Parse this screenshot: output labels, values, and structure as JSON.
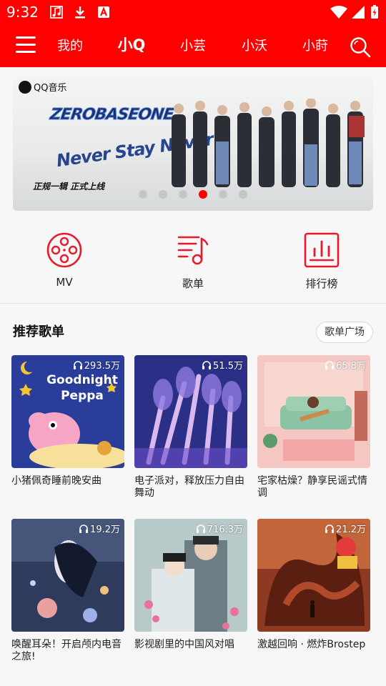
{
  "status_bar": {
    "time": "9:32",
    "left_icons": [
      "music-note-icon",
      "download-icon",
      "app-notification-icon"
    ],
    "right_icons": [
      "wifi-icon",
      "signal-icon",
      "battery-icon"
    ]
  },
  "nav": {
    "tabs": [
      {
        "label": "我的",
        "active": false
      },
      {
        "label": "小Q",
        "active": true
      },
      {
        "label": "小芸",
        "active": false
      },
      {
        "label": "小沃",
        "active": false
      },
      {
        "label": "小莳",
        "active": false
      }
    ]
  },
  "banner": {
    "brand": "QQ音乐",
    "title_line1": "ZEROBASEONE",
    "title_line2": "Never Stay Never",
    "subtitle": "正规一辑 正式上线",
    "active_dot": 3,
    "dot_count": 6
  },
  "quick_actions": [
    {
      "label": "MV",
      "icon": "film-reel-icon"
    },
    {
      "label": "歌单",
      "icon": "playlist-icon"
    },
    {
      "label": "排行榜",
      "icon": "chart-icon"
    }
  ],
  "section": {
    "title": "推荐歌单",
    "more_label": "歌单广场"
  },
  "playlists": [
    {
      "title": "小猪佩奇睡前晚安曲",
      "plays": "293.5万",
      "cover_text": "Goodnight Peppa"
    },
    {
      "title": "电子派对，释放压力自由舞动",
      "plays": "51.5万"
    },
    {
      "title": "宅家枯燥？静享民谣式情调",
      "plays": "65.8万"
    },
    {
      "title": "唤醒耳朵！开启颅内电音之旅!",
      "plays": "19.2万"
    },
    {
      "title": "影视剧里的中国风对唱",
      "plays": "716.3万"
    },
    {
      "title": "激越回响 · 燃炸Brostep",
      "plays": "21.2万"
    }
  ],
  "colors": {
    "brand_red": "#ff0000",
    "accent_red": "#e8192c"
  }
}
